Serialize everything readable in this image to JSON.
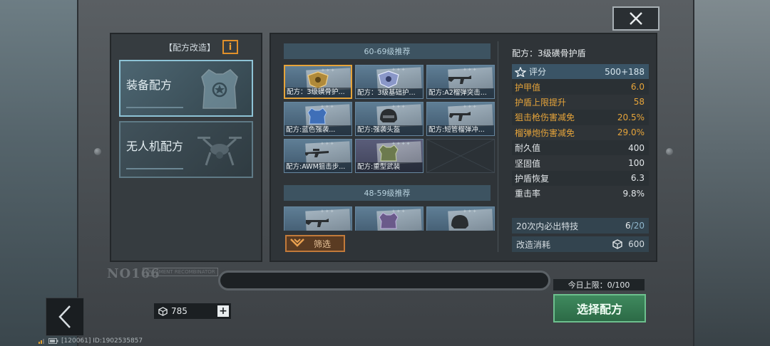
{
  "close_icon": "close-x-icon",
  "left_panel": {
    "title": "【配方改造】",
    "info_label": "i",
    "categories": [
      {
        "label": "装备配方",
        "icon": "armor-vest-icon",
        "active": true
      },
      {
        "label": "无人机配方",
        "icon": "drone-icon",
        "active": false
      }
    ],
    "plate_text": "NO166",
    "plate_sub": "FRAGMENT RECOMBINATOR"
  },
  "sections": [
    {
      "header": "60-69级推荐",
      "items": [
        {
          "label": "配方：3级磺骨护...",
          "selected": true,
          "icon": "shield-icon"
        },
        {
          "label": "配方：3级基础护...",
          "icon": "shield-icon"
        },
        {
          "label": "配方:A2榴弹突击...",
          "icon": "rifle-icon"
        },
        {
          "label": "配方:蓝色强袭...",
          "icon": "armor-icon"
        },
        {
          "label": "配方:强袭头盔",
          "icon": "helmet-icon"
        },
        {
          "label": "配方:短管榴弹冲...",
          "icon": "rifle-icon"
        },
        {
          "label": "配方:AWM狙击步...",
          "icon": "sniper-icon"
        },
        {
          "label": "配方:重型武装",
          "icon": "armor-icon"
        },
        {
          "label": "",
          "empty": true
        }
      ]
    },
    {
      "header": "48-59级推荐",
      "items": [
        {
          "label": "",
          "icon": "rifle-icon"
        },
        {
          "label": "",
          "icon": "armor-icon"
        },
        {
          "label": "",
          "icon": "helmet-icon"
        }
      ]
    }
  ],
  "filter_label": "筛选",
  "detail": {
    "title": "配方：3级磺骨护盾",
    "score_label": "评分",
    "score_value": "500+188",
    "stats": [
      {
        "name": "护甲值",
        "value": "6.0",
        "highlight": true
      },
      {
        "name": "护盾上限提升",
        "value": "58",
        "highlight": true
      },
      {
        "name": "狙击枪伤害减免",
        "value": "20.5%",
        "highlight": true
      },
      {
        "name": "榴弹炮伤害减免",
        "value": "29.0%",
        "highlight": true
      },
      {
        "name": "耐久值",
        "value": "400",
        "highlight": false
      },
      {
        "name": "坚固值",
        "value": "100",
        "highlight": false
      },
      {
        "name": "护盾恢复",
        "value": "6.3",
        "highlight": false
      },
      {
        "name": "重击率",
        "value": "9.8%",
        "highlight": false
      }
    ],
    "guarantee_label": "20次内必出特技",
    "guarantee_current": "6",
    "guarantee_total": "/20",
    "cost_label": "改造消耗",
    "cost_value": "600"
  },
  "daily_limit": "今日上限：0/100",
  "select_button": "选择配方",
  "currency_value": "785",
  "plus_label": "+",
  "status_text": "[120061] ID:1902535857",
  "colors": {
    "accent_orange": "#e6a43a",
    "select_green": "#3f8a5e",
    "header_blue": "#3d5361"
  }
}
